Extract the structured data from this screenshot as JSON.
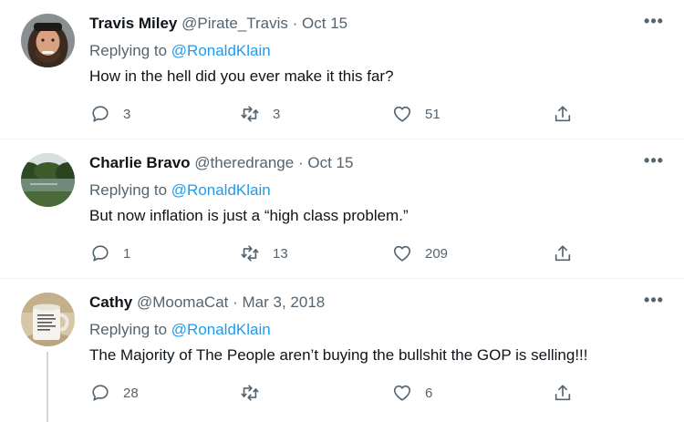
{
  "tweets": [
    {
      "name": "Travis Miley",
      "handle": "@Pirate_Travis",
      "separator": "·",
      "date": "Oct 15",
      "replying_prefix": "Replying to ",
      "replying_to": "@RonaldKlain",
      "text": "How in the hell did you ever make it this far?",
      "replies": "3",
      "retweets": "3",
      "likes": "51",
      "more": "•••"
    },
    {
      "name": "Charlie Bravo",
      "handle": "@theredrange",
      "separator": "·",
      "date": "Oct 15",
      "replying_prefix": "Replying to ",
      "replying_to": "@RonaldKlain",
      "text": "But now inflation is just a “high class problem.”",
      "replies": "1",
      "retweets": "13",
      "likes": "209",
      "more": "•••"
    },
    {
      "name": "Cathy",
      "handle": "@MoomaCat",
      "separator": "·",
      "date": "Mar 3, 2018",
      "replying_prefix": "Replying to ",
      "replying_to": "@RonaldKlain",
      "text": "The Majority of The People aren’t buying the bullshit the GOP is selling!!!",
      "replies": "28",
      "retweets": "",
      "likes": "6",
      "more": "•••"
    }
  ],
  "colors": {
    "text": "#0f1419",
    "secondary": "#536471",
    "link": "#1d9bf0",
    "divider": "#eff3f4",
    "thread_line": "#cfd9de"
  }
}
